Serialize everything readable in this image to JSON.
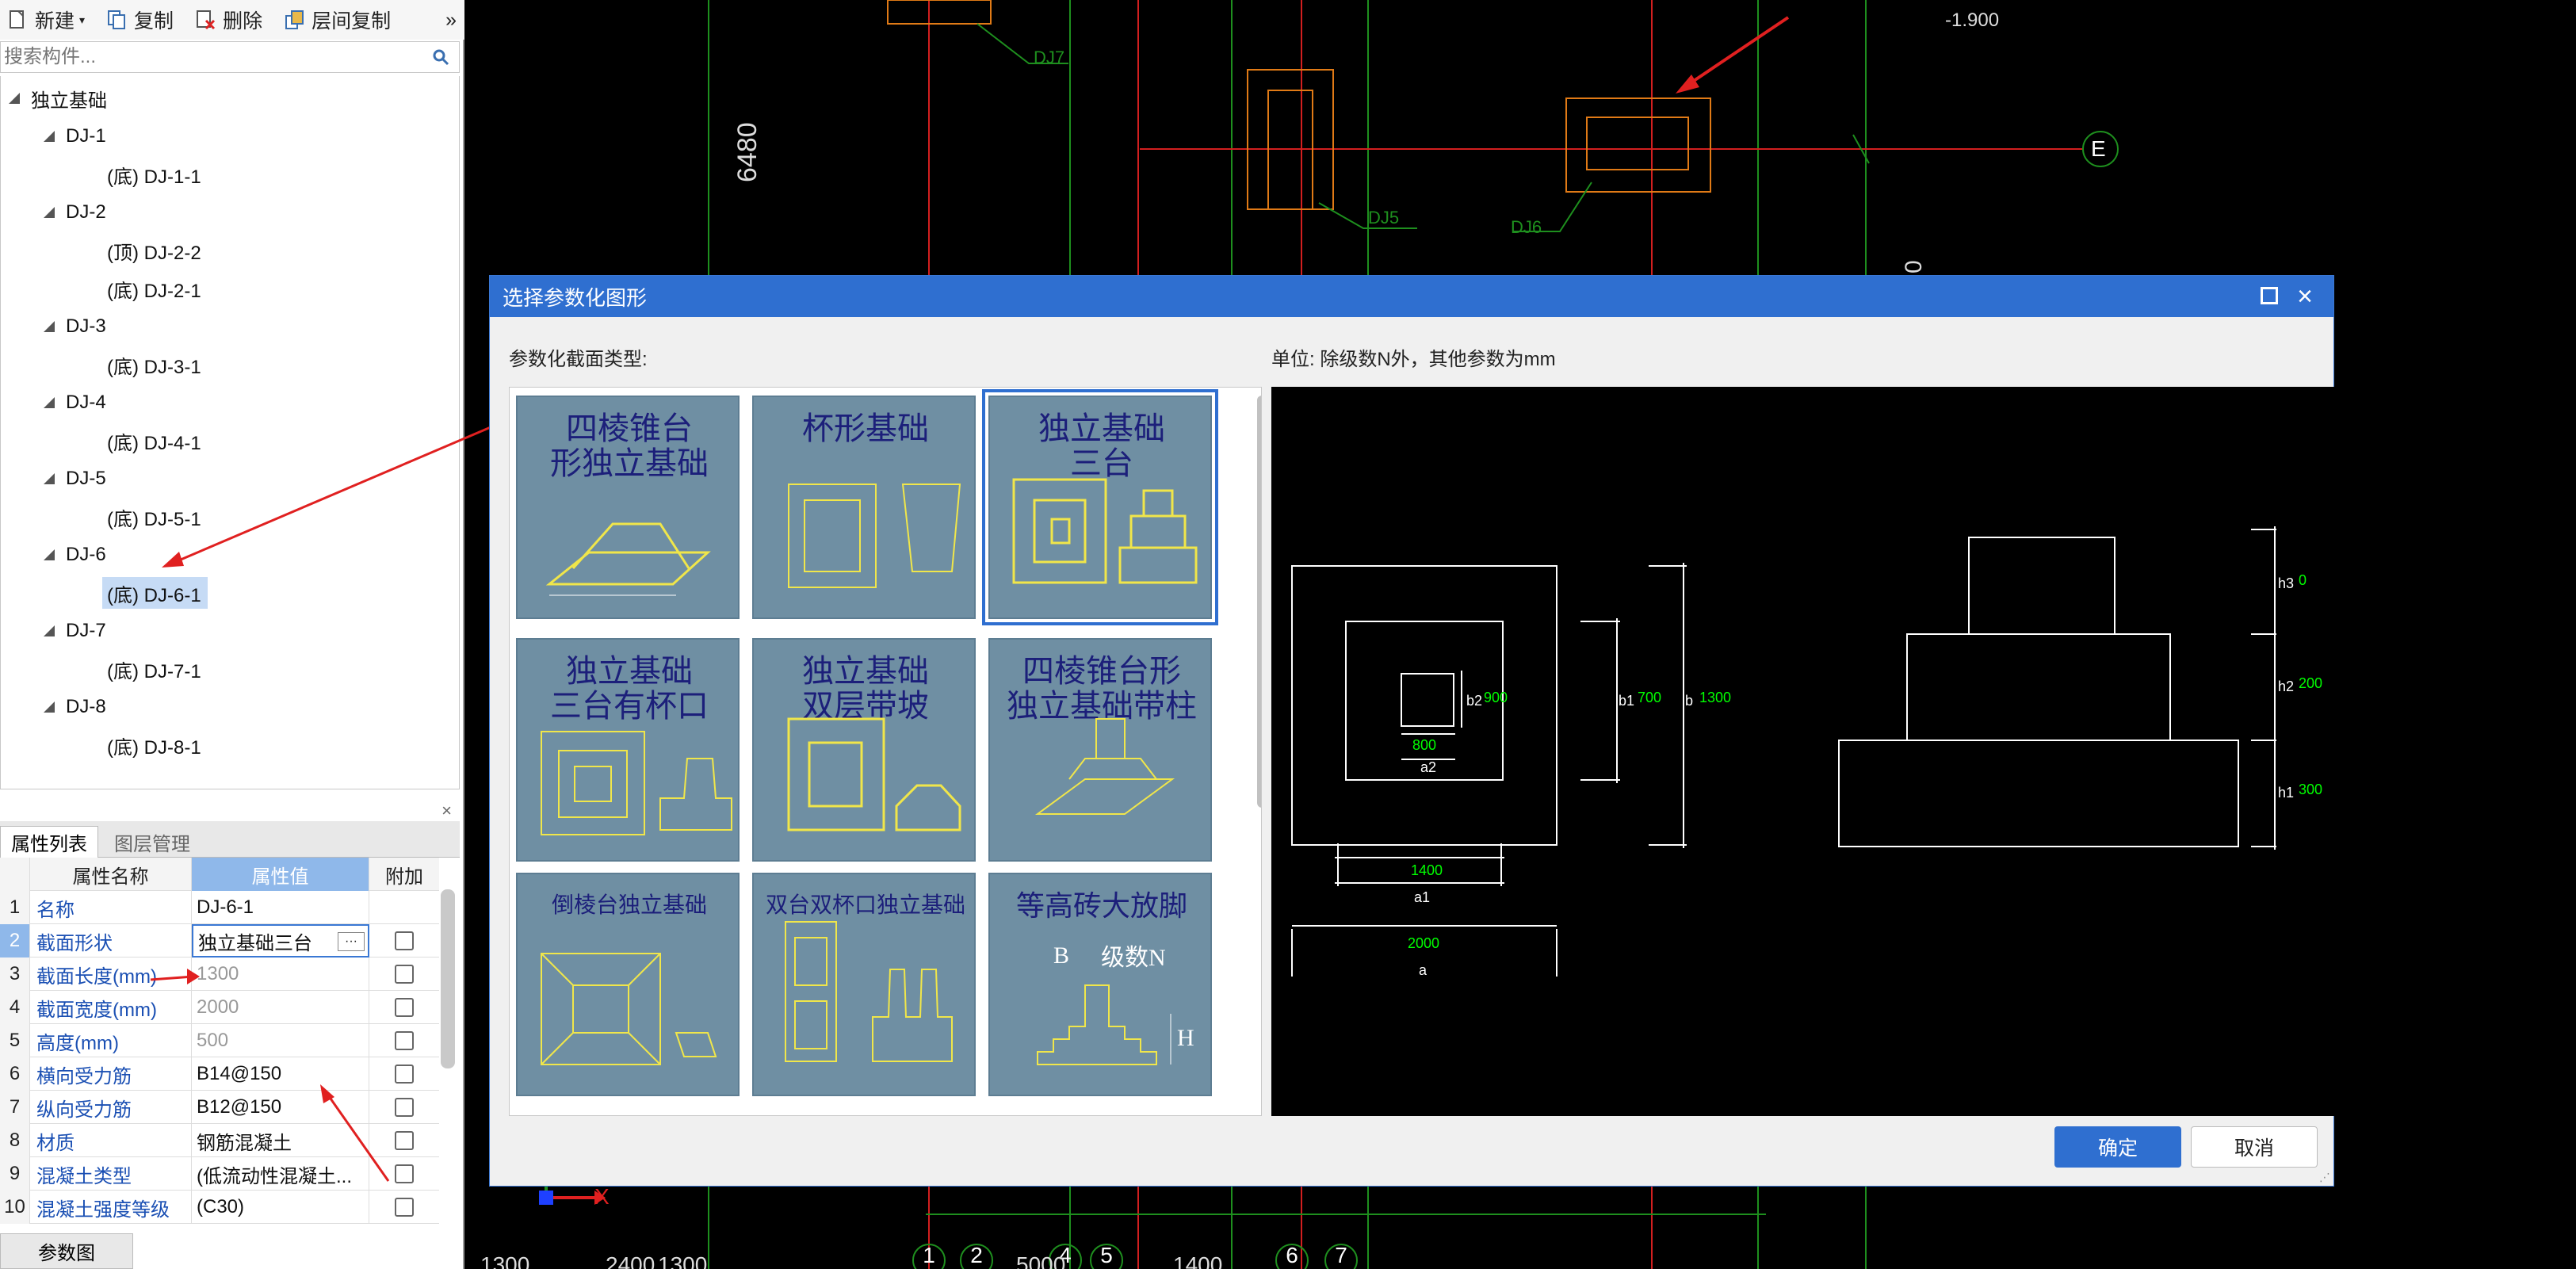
{
  "toolbar": {
    "new_label": "新建",
    "copy_label": "复制",
    "delete_label": "删除",
    "floor_copy_label": "层间复制",
    "more_label": "»"
  },
  "search": {
    "placeholder": "搜索构件..."
  },
  "tree": {
    "root": "独立基础",
    "groups": [
      {
        "label": "DJ-1",
        "children": [
          "(底) DJ-1-1"
        ]
      },
      {
        "label": "DJ-2",
        "children": [
          "(顶) DJ-2-2",
          "(底) DJ-2-1"
        ]
      },
      {
        "label": "DJ-3",
        "children": [
          "(底) DJ-3-1"
        ]
      },
      {
        "label": "DJ-4",
        "children": [
          "(底) DJ-4-1"
        ]
      },
      {
        "label": "DJ-5",
        "children": [
          "(底) DJ-5-1"
        ]
      },
      {
        "label": "DJ-6",
        "children": [
          "(底) DJ-6-1"
        ]
      },
      {
        "label": "DJ-7",
        "children": [
          "(底) DJ-7-1"
        ]
      },
      {
        "label": "DJ-8",
        "children": [
          "(底) DJ-8-1"
        ]
      }
    ],
    "selected": "(底) DJ-6-1"
  },
  "props": {
    "tabs": [
      "属性列表",
      "图层管理"
    ],
    "headers": [
      "属性名称",
      "属性值",
      "附加"
    ],
    "rows": [
      {
        "n": "1",
        "k": "名称",
        "v": "DJ-6-1",
        "cb": false
      },
      {
        "n": "2",
        "k": "截面形状",
        "v": "独立基础三台",
        "cb": true
      },
      {
        "n": "3",
        "k": "截面长度(mm)",
        "v": "1300",
        "cb": true
      },
      {
        "n": "4",
        "k": "截面宽度(mm)",
        "v": "2000",
        "cb": true
      },
      {
        "n": "5",
        "k": "高度(mm)",
        "v": "500",
        "cb": true
      },
      {
        "n": "6",
        "k": "横向受力筋",
        "v": "B14@150",
        "cb": true
      },
      {
        "n": "7",
        "k": "纵向受力筋",
        "v": "B12@150",
        "cb": true
      },
      {
        "n": "8",
        "k": "材质",
        "v": "钢筋混凝土",
        "cb": true
      },
      {
        "n": "9",
        "k": "混凝土类型",
        "v": "(低流动性混凝土...",
        "cb": true
      },
      {
        "n": "10",
        "k": "混凝土强度等级",
        "v": "(C30)",
        "cb": true
      }
    ],
    "edit_btn": "···",
    "close_x": "×"
  },
  "bottom_tab": "参数图",
  "cad": {
    "labels": {
      "dj7": "DJ7",
      "dj5": "DJ5",
      "dj6": "DJ6",
      "elev": "-1.900",
      "dim6480": "6480",
      "zero": "0",
      "axisE": "E",
      "axisX": "X"
    },
    "axes_bottom": [
      "1",
      "2",
      "4",
      "5",
      "6",
      "7"
    ],
    "dims_bottom": [
      "1300",
      "2400",
      "1300",
      "5000",
      "1400"
    ]
  },
  "dialog": {
    "title": "选择参数化图形",
    "label_types": "参数化截面类型:",
    "label_units": "单位:   除级数N外，其他参数为mm",
    "ok": "确定",
    "cancel": "取消",
    "cards": [
      "四棱锥台\n形独立基础",
      "杯形基础",
      "独立基础\n三台",
      "独立基础\n三台有杯口",
      "独立基础\n双层带坡",
      "四棱锥台形\n独立基础带柱",
      "倒棱台独立基础",
      "双台双杯口独立基础",
      "等高砖大放脚"
    ],
    "card_notes": {
      "card8_n": "级数N",
      "card8_b": "B",
      "card8_h": "H"
    },
    "selected_card": 2,
    "preview": {
      "dims": {
        "h3_val": "0",
        "h2_val": "200",
        "h1_val": "300",
        "b2_val": "900",
        "b1_val": "700",
        "b_val": "1300",
        "a2_val": "800",
        "a1_val": "1400",
        "a_val": "2000"
      },
      "labels": {
        "h3": "h3",
        "h2": "h2",
        "h1": "h1",
        "b2": "b2",
        "b1": "b1",
        "b": "b",
        "a2": "a2",
        "a1": "a1",
        "a": "a"
      },
      "colors": {
        "line": "#ffffff",
        "value": "#00ff00"
      }
    }
  }
}
